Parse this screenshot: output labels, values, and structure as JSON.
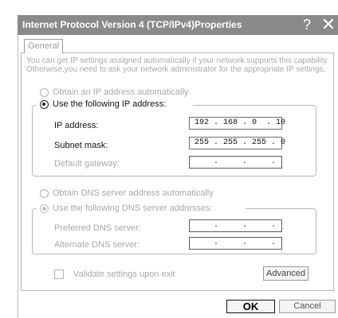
{
  "window": {
    "title": "Internet Protocol Version 4 (TCP/IPv4)Properties",
    "help_glyph": "?",
    "close_glyph": "✕"
  },
  "tabs": [
    {
      "label": "General"
    }
  ],
  "general": {
    "description": "You can get IP settings assigned automatically if your network supports this capability. Otherwise,you need to ask your network administrator for the appropriate IP settings.",
    "ip_mode": {
      "auto_label": "Obtain an IP address automatically",
      "manual_label": "Use the following IP address:",
      "selected": "manual"
    },
    "ip_fields": {
      "ip_address": {
        "label": "IP address:",
        "value": "192 . 168 . 0  . 10"
      },
      "subnet_mask": {
        "label": "Subnet mask:",
        "value": "255 . 255 . 255 . 0"
      },
      "default_gateway": {
        "label": "Default gateway:",
        "value": "    .     .     ."
      }
    },
    "dns_mode": {
      "auto_label": "Obtain DNS server address automatically",
      "manual_label": "Use the following DNS server addresses:",
      "selected": "manual"
    },
    "dns_fields": {
      "preferred": {
        "label": "Preferred DNS server:",
        "value": "    .     .     ."
      },
      "alternate": {
        "label": "Alternate DNS server:",
        "value": "    .     .     ."
      }
    },
    "validate": {
      "label": "Validate settings upon exit",
      "checked": false
    },
    "advanced_label": "Advanced"
  },
  "footer": {
    "ok_label": "OK",
    "cancel_label": "Cancel"
  },
  "colors": {
    "titlebar": "#8a8a8a",
    "disabled_text": "#a8a8a8",
    "border": "#b8b8b8"
  }
}
